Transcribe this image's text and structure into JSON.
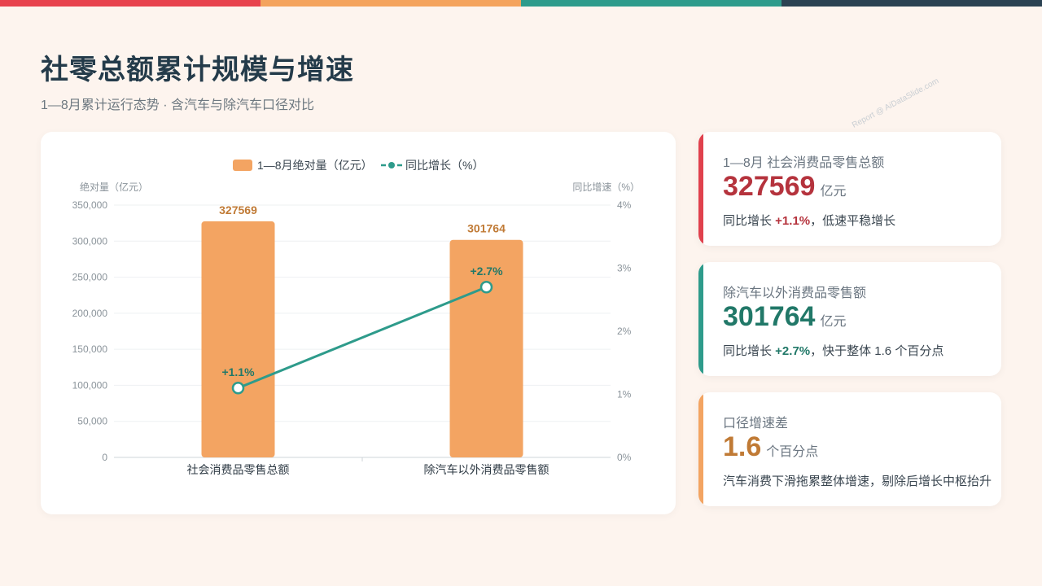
{
  "colors": {
    "top_bar": [
      "#e8424d",
      "#f4a35d",
      "#2e9b8b",
      "#2b4252"
    ],
    "bar": "#f3a462",
    "line": "#2e9b8b",
    "kpi1_accent": "#e0414d",
    "kpi1_value": "#b5333d",
    "kpi2_accent": "#2e9b8b",
    "kpi2_value": "#217868",
    "kpi3_accent": "#f3a462",
    "kpi3_value": "#c07a35"
  },
  "header": {
    "title": "社零总额累计规模与增速",
    "subtitle": "1—8月累计运行态势 · 含汽车与除汽车口径对比"
  },
  "watermark": "Report @ AiDataSlide.com",
  "chart_data": {
    "type": "bar+line",
    "categories": [
      "社会消费品零售总额",
      "除汽车以外消费品零售额"
    ],
    "series": [
      {
        "name": "1—8月绝对量（亿元）",
        "type": "bar",
        "axis": "left",
        "values": [
          327569,
          301764
        ],
        "labels": [
          "327569",
          "301764"
        ]
      },
      {
        "name": "同比增长（%）",
        "type": "line",
        "axis": "right",
        "values": [
          1.1,
          2.7
        ],
        "labels": [
          "+1.1%",
          "+2.7%"
        ]
      }
    ],
    "ylabel_left": "绝对量（亿元）",
    "ylabel_right": "同比增速（%）",
    "ylim_left": [
      0,
      350000
    ],
    "ylim_right": [
      0,
      4
    ],
    "yticks_left": [
      "0",
      "50,000",
      "100,000",
      "150,000",
      "200,000",
      "250,000",
      "300,000",
      "350,000"
    ],
    "yticks_right": [
      "0%",
      "1%",
      "2%",
      "3%",
      "4%"
    ],
    "grid": true,
    "legend_position": "top-center"
  },
  "kpis": [
    {
      "label": "1—8月 社会消费品零售总额",
      "value": "327569",
      "unit": "亿元",
      "note_prefix": "同比增长 ",
      "note_highlight": "+1.1%",
      "note_suffix": "，低速平稳增长"
    },
    {
      "label": "除汽车以外消费品零售额",
      "value": "301764",
      "unit": "亿元",
      "note_prefix": "同比增长 ",
      "note_highlight": "+2.7%",
      "note_suffix": "，快于整体 1.6 个百分点"
    },
    {
      "label": "口径增速差",
      "value": "1.6",
      "unit": "个百分点",
      "note_prefix": "汽车消费下滑拖累整体增速，剔除后增长中枢抬升",
      "note_highlight": "",
      "note_suffix": ""
    }
  ]
}
